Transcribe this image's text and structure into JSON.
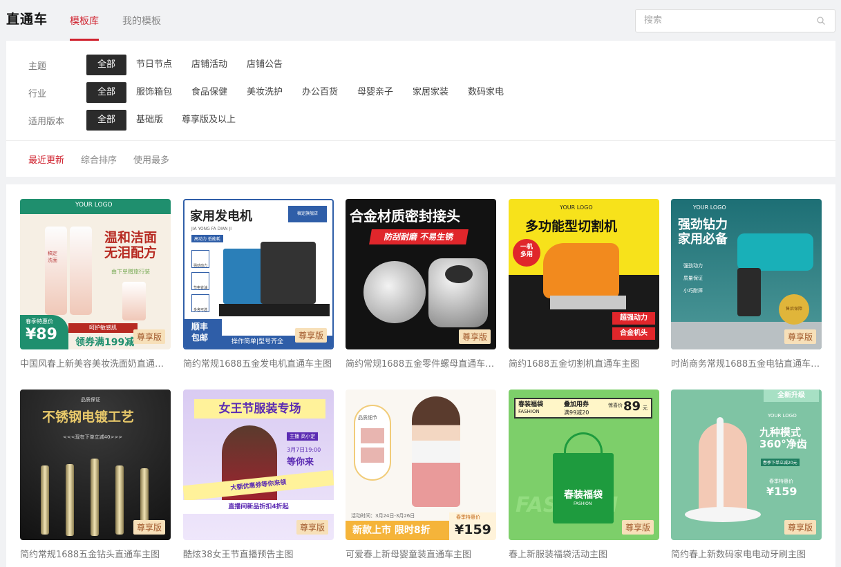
{
  "header": {
    "app_title": "直通车",
    "tabs": [
      {
        "label": "模板库",
        "active": true
      },
      {
        "label": "我的模板",
        "active": false
      }
    ],
    "search_placeholder": "搜索"
  },
  "filters": [
    {
      "label": "主题",
      "options": [
        "全部",
        "节日节点",
        "店铺活动",
        "店铺公告"
      ],
      "selected": "全部"
    },
    {
      "label": "行业",
      "options": [
        "全部",
        "服饰箱包",
        "食品保健",
        "美妆洗护",
        "办公百货",
        "母婴亲子",
        "家居家装",
        "数码家电"
      ],
      "selected": "全部"
    },
    {
      "label": "适用版本",
      "options": [
        "全部",
        "基础版",
        "尊享版及以上"
      ],
      "selected": "全部"
    }
  ],
  "sort": {
    "options": [
      "最近更新",
      "综合排序",
      "使用最多"
    ],
    "selected": "最近更新"
  },
  "badge_label": "尊享版",
  "colors": {
    "accent": "#d0222e",
    "badge_bg": "#f7e0b9",
    "badge_text": "#a0582b"
  },
  "templates": [
    {
      "title": "中国风春上新美容美妆洗面奶直通车主图",
      "thumb": {
        "logo": "YOUR LOGO",
        "headline": "温和洁面\n无泪配方",
        "line1": "春季特惠价",
        "price": "¥89",
        "line2": "领券满199减",
        "line3": "呵护敏感肌",
        "line4": "由下单赠旅行装",
        "product_text": "稿定\n洗面"
      }
    },
    {
      "title": "简约常规1688五金发电机直通车主图",
      "thumb": {
        "headline": "家用发电机",
        "sub": "JIA YONG FA DIAN JI",
        "shop": "稿定旗舰店",
        "tag": "高动力 低能耗",
        "features": [
          "强劲动力",
          "节电省油",
          "多舍可选"
        ],
        "bottom_left": "顺丰\n包邮",
        "bottom_right": "操作简单|型号齐全"
      }
    },
    {
      "title": "简约常规1688五金零件螺母直通车主图",
      "thumb": {
        "headline": "合金材质密封接头",
        "sub": "防刮耐磨  不易生锈"
      }
    },
    {
      "title": "简约1688五金切割机直通车主图",
      "thumb": {
        "logo": "YOUR LOGO",
        "headline": "多功能型切割机",
        "circle": "一机\n多用",
        "tag1": "超强动力",
        "tag2": "合金机头"
      }
    },
    {
      "title": "时尚商务常规1688五金电钻直通车主图",
      "thumb": {
        "logo": "YOUR LOGO",
        "headline": "强劲钻力\n家用必备",
        "features": [
          "强劲动力",
          "质量保证",
          "小巧耐摔"
        ],
        "medal": "售后保障"
      }
    },
    {
      "title": "简约常规1688五金钻头直通车主图",
      "thumb": {
        "tag": "品质保证",
        "headline": "不锈钢电镀工艺",
        "sub": "<<<现在下单立减40>>>"
      }
    },
    {
      "title": "酷炫38女王节直播预告主图",
      "thumb": {
        "headline": "女王节服装专场",
        "tag": "主播 高小定",
        "date": "3月7日19:00",
        "cta": "等你来",
        "coupon": "大额优惠券等你来领",
        "bottom": "直播间新品折扣4折起"
      }
    },
    {
      "title": "可爱春上新母婴童装直通车主图",
      "thumb": {
        "label": "品质细节",
        "time": "活动时间：3月24日-3月26日",
        "headline": "新款上市 限时8折",
        "price_label": "春季特惠价",
        "price": "¥159"
      }
    },
    {
      "title": "春上新服装福袋活动主图",
      "thumb": {
        "top1": "春装福袋",
        "top1_sub": "FASHION",
        "top2": "叠加用券",
        "top2_sub": "满99减20",
        "price_label": "惊喜价",
        "price": "89",
        "unit": "元",
        "bag": "春装福袋",
        "bag_sub": "FASHION",
        "bg_word": "FASHION"
      }
    },
    {
      "title": "简约春上新数码家电电动牙刷主图",
      "thumb": {
        "ribbon": "全新升级",
        "logo": "YOUR LOGO",
        "headline": "九种模式\n360°净齿",
        "sub": "春季下单立减20元",
        "price_label": "春季特惠价",
        "price": "¥159"
      }
    }
  ]
}
